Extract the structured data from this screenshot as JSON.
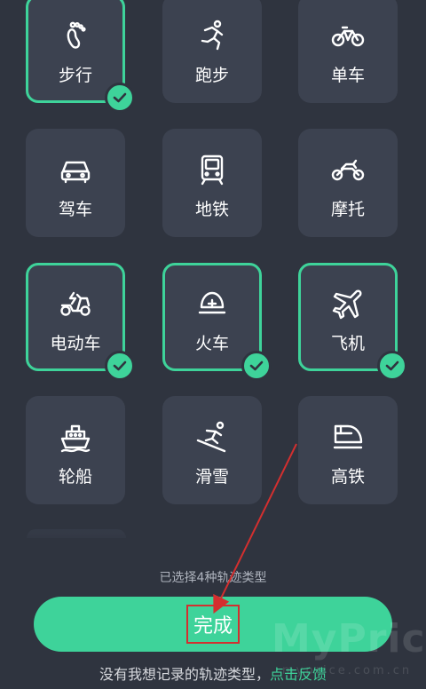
{
  "tiles": [
    {
      "label": "步行",
      "icon": "footprint-icon",
      "selected": true
    },
    {
      "label": "跑步",
      "icon": "running-icon",
      "selected": false
    },
    {
      "label": "单车",
      "icon": "bicycle-icon",
      "selected": false
    },
    {
      "label": "驾车",
      "icon": "car-icon",
      "selected": false
    },
    {
      "label": "地铁",
      "icon": "subway-icon",
      "selected": false
    },
    {
      "label": "摩托",
      "icon": "motorcycle-icon",
      "selected": false
    },
    {
      "label": "电动车",
      "icon": "e-scooter-icon",
      "selected": true
    },
    {
      "label": "火车",
      "icon": "train-icon",
      "selected": true
    },
    {
      "label": "飞机",
      "icon": "airplane-icon",
      "selected": true
    },
    {
      "label": "轮船",
      "icon": "ship-icon",
      "selected": false
    },
    {
      "label": "滑雪",
      "icon": "skiing-icon",
      "selected": false
    },
    {
      "label": "高铁",
      "icon": "high-speed-rail-icon",
      "selected": false
    }
  ],
  "status_text": "已选择4种轨迹类型",
  "done_label": "完成",
  "feedback": {
    "prefix": "没有我想记录的轨迹类型，",
    "link": "点击反馈"
  },
  "watermark": {
    "title": "MyPrice",
    "sub": "myprice.com.cn"
  },
  "colors": {
    "background": "#2f343f",
    "tile": "#3c4250",
    "accent": "#3ed39a",
    "annotation": "#d32f2f"
  }
}
